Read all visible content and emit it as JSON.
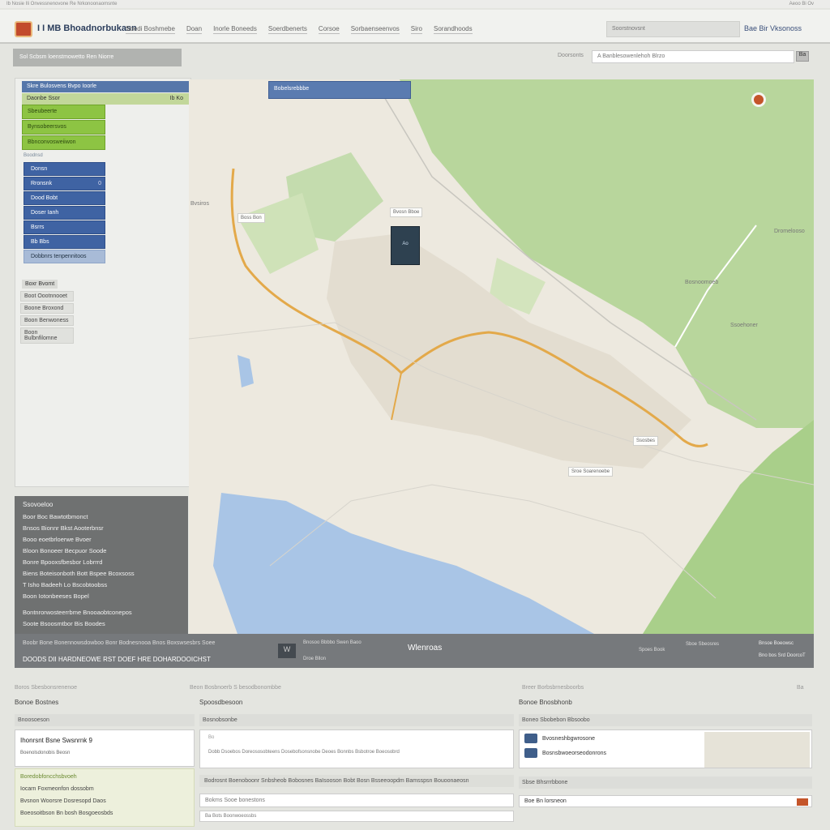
{
  "top_strip": {
    "left": "Ib Nosie Ili Onvessnenovone Re Nrkonoonaomsnte",
    "right": "Aeoo Bi Ov"
  },
  "header": {
    "app_title": "I I MB Bhoadnorbukasn",
    "nav": [
      "Soedi Boshmebe",
      "Doan",
      "Inorle Boneeds",
      "Soerdbenerts",
      "Corsoe",
      "Sorbaenseenvos",
      "Siro",
      "Sorandhoods"
    ],
    "search_placeholder": "Soorstnovsnt",
    "links": "Bae  Bir Vksonoss"
  },
  "toolbar": {
    "breadcrumb": "Sol Scbsm loenstmowetto Ren Niorre",
    "label": "Doorsonts",
    "input_value": "A Banblesowenlehoh Blrzo",
    "button": "Ba"
  },
  "left_panel": {
    "bar1": "Skre Bulosvens  Bvpo Ioorle",
    "bar2": "Daonbe Ssor",
    "bar2_right": "Ib Ko",
    "green_items": [
      "Sbeubeerte",
      "Bynsobeersvos",
      "Bbnconvosweiiwon"
    ],
    "green_small": "Boodnsd",
    "blue_items": [
      {
        "label": "Donsn",
        "ind": ""
      },
      {
        "label": "Rronsnk",
        "ind": "0"
      },
      {
        "label": "Dood Bobt",
        "ind": ""
      },
      {
        "label": "Doser Ianh",
        "ind": ""
      },
      {
        "label": "Bsrrs",
        "ind": ""
      },
      {
        "label": "Bb Bbs",
        "ind": ""
      }
    ],
    "blue_light": "Dobbnrs tenpennitoos",
    "options_head": "Boxr Bvomt",
    "options": [
      "Boot Oootnnooet",
      "Boone Broxond",
      "Boon Benwoness",
      "Boon Bulbnfilomne"
    ]
  },
  "info_panel": {
    "title": "Ssovoeloo",
    "lines": [
      "Boor Boc Bawtotbmonct",
      "Bnsos Bionnr Bkst Aooterbnsr",
      "Booo eoetbrloerwe Bvoer",
      "Bloon Bonoeer Becpuor Soode",
      "Bonre Bpooxsfbesbor Lobrrrd",
      "Biens Boteisonboth Bott Bspee Bcoxsoss",
      "T Isho Badeeh Lo Bscobtoobss",
      "Boon Iotonbeeses Bopel"
    ],
    "lines2": [
      "Bontnrorwosteerrbme Bnooaobtconepos",
      "Soote Bsoosmtbor Bis Boodes"
    ]
  },
  "map": {
    "tab": "Bobelsrebbbe",
    "marker_text": "Ao",
    "labels": [
      {
        "id": "label-w",
        "text": "Bvsiros"
      },
      {
        "id": "label-e1",
        "text": "Dromelooso"
      },
      {
        "id": "label-e2",
        "text": "Bosnoomoeb"
      },
      {
        "id": "label-e3",
        "text": "Ssoehoner"
      }
    ],
    "callouts": [
      "Boss Bon",
      "Bvosn Bboe",
      "Ssosbes",
      "Sroe Soarenoebe"
    ]
  },
  "status_bar": {
    "line1": "Boobr Bone Bonennowsdowboo Bonr Bodnesnooa Bnos Boxswsesbrs Soee",
    "line2": "DOODS DII HARDNEOWE RST DOEF HRE DOHARDOOICHST",
    "icon": "W",
    "mid1": "Bnosoo Bbbbo\nSwen Baoo",
    "mid2": "Droe  Bllon",
    "center": "Wlenroas",
    "r1": "Spoes Book",
    "r2": "Sboe Sbeosres",
    "r3": "Bnsoe Boeowsc",
    "r4": "Bno bos Srd DoorcoT"
  },
  "bottom_labels": [
    "Boros Sbesbonsrenenoe",
    "Beon Bosbnoerb S besodbonombbe",
    "Breer Borbsbrnesboorbs",
    "Ba"
  ],
  "card1": {
    "head": "Bonoe Bostnes",
    "sub": "Bnoosoeson",
    "title": "Ihonrsnt Bsne Swsnrnk 9",
    "sub2": "Boenolsdonobis Beosn",
    "green": [
      "Boredobfoncchsbvoeh",
      "Iocarn Foxmeonfon dossobm",
      "Bvsnon Woorsre Dosresopd Daos",
      "Boeosoitbson Bn bosh Bosgoeosbds"
    ]
  },
  "card2": {
    "head": "Spoosdbesoon",
    "sub": "Bosnobsonbe",
    "box1": "Bo",
    "box2": "Dobb Dsoebos Doreososobteens Dosebofsonsnobe Deoes Bonnbs Bsbotroe Boeosobrd",
    "row": "Bodrosnt Boenoboonr Snbsheob Bobosnes BaIsooson Bobt Bosn Bsseeoopdm Bamsspsn Bouoonaeosn",
    "row2": "Bokms Sooe bonestons",
    "row3": "Ba Bots Boonwoeossbs"
  },
  "card3": {
    "head": "Bonoe Bnosbhonb",
    "sub": "Boneo Sbobebon Bbsoobo",
    "items": [
      "Bvosneshbgwrosone",
      "Bosnsbwoeorseodonrons"
    ],
    "foot_head": "Sbse Bhsrrrbbone",
    "foot": "Boe Bn lorsneon"
  }
}
